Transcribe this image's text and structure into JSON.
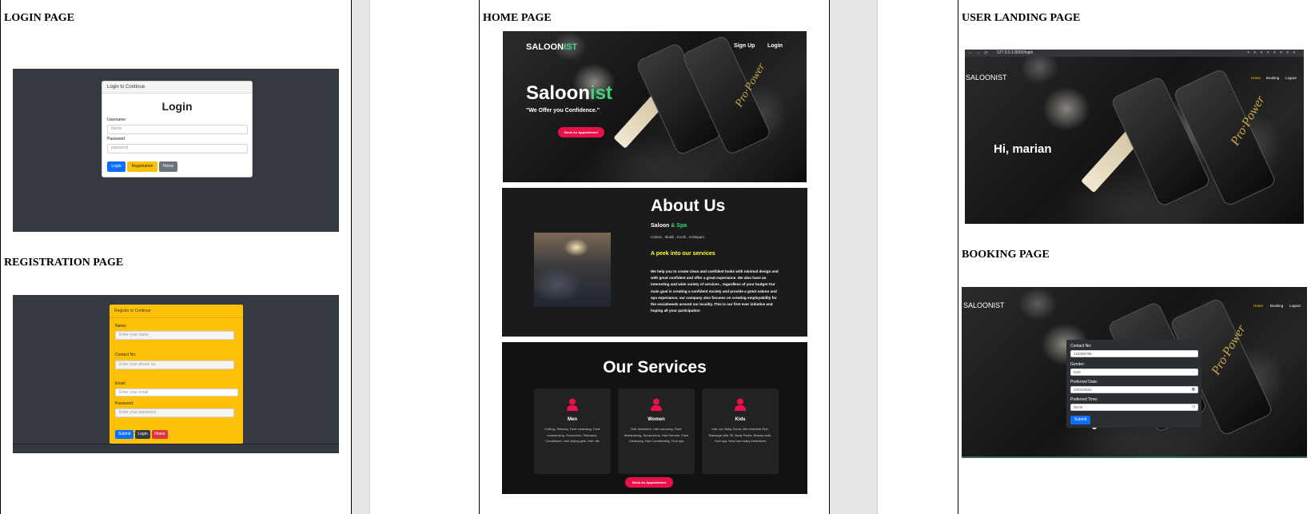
{
  "headings": {
    "login": "LOGIN PAGE",
    "registration": "REGISTRATION PAGE",
    "home": "HOME PAGE",
    "user_landing": "USER LANDING PAGE",
    "booking": "BOOKING PAGE"
  },
  "login": {
    "card_header": "Login to Continue",
    "title": "Login",
    "username_label": "Username",
    "username_placeholder": "Name",
    "password_label": "Password",
    "password_placeholder": "password",
    "buttons": [
      "Login",
      "Registration",
      "Home"
    ]
  },
  "registration": {
    "card_header": "Register to Continue",
    "fields": [
      {
        "label": "Name:",
        "placeholder": "Enter your name"
      },
      {
        "label": "Contact No:",
        "placeholder": "Enter your phone no."
      },
      {
        "label": "Email:",
        "placeholder": "Enter your email"
      },
      {
        "label": "Password:",
        "placeholder": "Enter your password"
      }
    ],
    "buttons": [
      "Submit",
      "Login",
      "Home"
    ]
  },
  "home": {
    "hero": {
      "logo_main": "SALOON",
      "logo_accent": "IST",
      "nav": [
        "Sign Up",
        "Login"
      ],
      "title_main": "Saloon",
      "title_accent": "ist",
      "tagline": "\"We Offer you Confidence.\"",
      "cta": "Book An Appointment"
    },
    "about": {
      "title": "About Us",
      "sub_main": "Saloon",
      "sub_accent": "& Spa",
      "locations": "Calicut , Idukki , Kochi , Kottayam.",
      "peek": "A peek into our services",
      "body": "We help you to create clean and confident looks with minimal design and with great confident and offer a great experiance. We also have an interesting and wide variety of services , regardless of your budget Our main goal is creating a confident society and provide a great saloon and spa experiance, our company also focuses on creating employability for the socialneeds around our locality. This is our first ever initiative and hoping all your participation"
    },
    "services": {
      "title": "Our Services",
      "cards": [
        {
          "name": "Men",
          "desc": "Cutting, Shaving, Face cleansing, Face moisturizing, Sunscreen, Shampoo, Conditioner, Hair styling gels, Hair oils"
        },
        {
          "name": "Women",
          "desc": "Hair treatment, Hair colouring, Face Moisturising, Sunscreens, Hair Serums, Face Cleansing, Hair Conditioning, Foot spa"
        },
        {
          "name": "Kids",
          "desc": "Hair cut, Baby Scrub, Mix Kashmiri Rub, Massage with Oil, Body Packs, Beauty bath, Foot spa, New born baby treatments"
        }
      ],
      "cta": "Book An Appointment"
    }
  },
  "user_landing": {
    "url": "127.0.0.1:8000/login",
    "brand": "SALOONIST",
    "nav": [
      "Home",
      "Booking",
      "Logout"
    ],
    "greeting": "Hi, marian"
  },
  "booking": {
    "brand": "SALOONIST",
    "nav": [
      "Home",
      "Booking",
      "Logout"
    ],
    "fields": [
      {
        "label": "Contact No:",
        "value": "123456789"
      },
      {
        "label": "Gender:",
        "value": "Kids"
      },
      {
        "label": "Preferred Date:",
        "value": "23/01/2023"
      },
      {
        "label": "Preferred Time:",
        "value": "05:05"
      }
    ],
    "submit": "Submit"
  },
  "colors": {
    "accent_green": "#3fd37a",
    "accent_pink": "#e8114c",
    "accent_yellow": "#ffc107",
    "btn_blue": "#0d6efd",
    "btn_gray": "#6c757d",
    "btn_red": "#dc3545"
  }
}
